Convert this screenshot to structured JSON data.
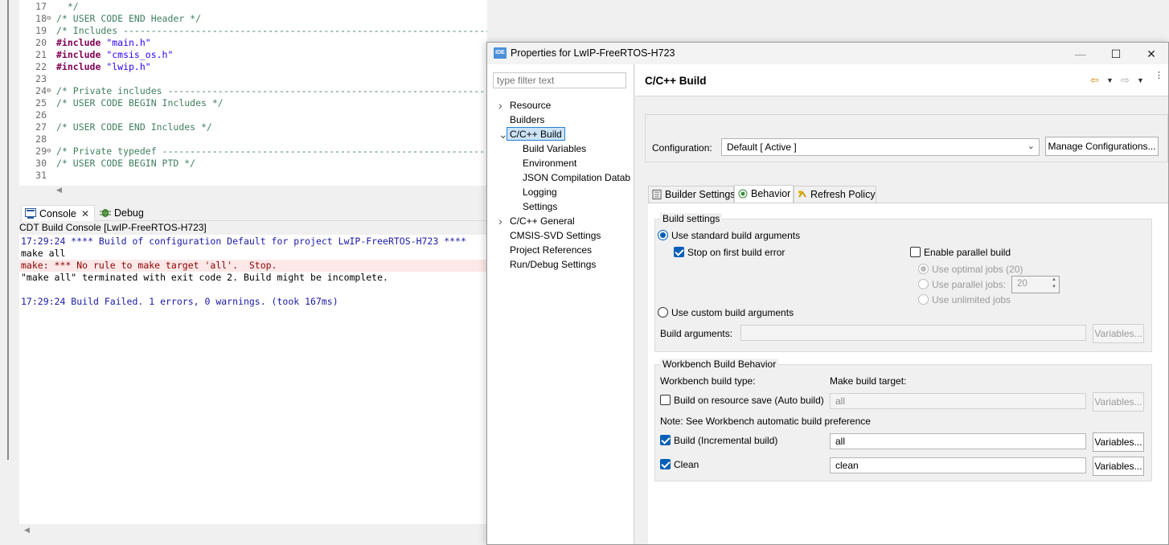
{
  "editor": {
    "lines": [
      {
        "num": "17",
        "fold": "",
        "segs": [
          {
            "t": "  */",
            "c": "c-comment"
          }
        ]
      },
      {
        "num": "18",
        "fold": "⊖",
        "segs": [
          {
            "t": "/* USER CODE END Header */",
            "c": "c-comment"
          }
        ]
      },
      {
        "num": "19",
        "fold": "",
        "segs": [
          {
            "t": "/* Includes ------------------------------------------------------------------*/",
            "c": "c-comment"
          }
        ]
      },
      {
        "num": "20",
        "fold": "",
        "segs": [
          {
            "t": "#include",
            "c": "c-kw"
          },
          {
            "t": " \"main.h\"",
            "c": "c-str"
          }
        ]
      },
      {
        "num": "21",
        "fold": "",
        "segs": [
          {
            "t": "#include",
            "c": "c-kw"
          },
          {
            "t": " \"cmsis_os.h\"",
            "c": "c-str"
          }
        ]
      },
      {
        "num": "22",
        "fold": "",
        "segs": [
          {
            "t": "#include",
            "c": "c-kw"
          },
          {
            "t": " \"lwip.h\"",
            "c": "c-str"
          }
        ]
      },
      {
        "num": "23",
        "fold": "",
        "segs": [
          {
            "t": "",
            "c": ""
          }
        ]
      },
      {
        "num": "24",
        "fold": "⊖",
        "segs": [
          {
            "t": "/* Private includes ----------------------------------------------------------",
            "c": "c-comment"
          }
        ]
      },
      {
        "num": "25",
        "fold": "",
        "segs": [
          {
            "t": "/* USER CODE BEGIN Includes */",
            "c": "c-comment"
          }
        ]
      },
      {
        "num": "26",
        "fold": "",
        "segs": [
          {
            "t": "",
            "c": ""
          }
        ]
      },
      {
        "num": "27",
        "fold": "",
        "segs": [
          {
            "t": "/* USER CODE END Includes */",
            "c": "c-comment"
          }
        ]
      },
      {
        "num": "28",
        "fold": "",
        "segs": [
          {
            "t": "",
            "c": ""
          }
        ]
      },
      {
        "num": "29",
        "fold": "⊖",
        "segs": [
          {
            "t": "/* Private typedef -----------------------------------------------------------",
            "c": "c-comment"
          }
        ]
      },
      {
        "num": "30",
        "fold": "",
        "segs": [
          {
            "t": "/* USER CODE BEGIN PTD */",
            "c": "c-comment"
          }
        ]
      },
      {
        "num": "31",
        "fold": "",
        "segs": [
          {
            "t": "",
            "c": ""
          }
        ]
      }
    ]
  },
  "console": {
    "tab_label": "Console",
    "debug_tab_label": "Debug",
    "title": "CDT Build Console [LwIP-FreeRTOS-H723]",
    "lines": [
      {
        "text": "17:29:24 **** Build of configuration Default for project LwIP-FreeRTOS-H723 ****",
        "style": "con-blue"
      },
      {
        "text": "make all",
        "style": ""
      },
      {
        "text": "make: *** No rule to make target 'all'.  Stop.",
        "style": "con-err"
      },
      {
        "text": "\"make all\" terminated with exit code 2. Build might be incomplete.",
        "style": ""
      },
      {
        "text": "",
        "style": ""
      },
      {
        "text": "17:29:24 Build Failed. 1 errors, 0 warnings. (took 167ms)",
        "style": "con-blue"
      }
    ]
  },
  "dialog": {
    "app_icon": "IDE",
    "title": "Properties for LwIP-FreeRTOS-H723",
    "window_controls": {
      "minimize": "—",
      "maximize": "☐",
      "close": "✕"
    },
    "filter_placeholder": "type filter text",
    "tree": [
      {
        "label": "Resource",
        "level": 0,
        "arrow": ">",
        "selected": false
      },
      {
        "label": "Builders",
        "level": 0,
        "arrow": "",
        "selected": false
      },
      {
        "label": "C/C++ Build",
        "level": 0,
        "arrow": "v",
        "selected": true
      },
      {
        "label": "Build Variables",
        "level": 1,
        "arrow": "",
        "selected": false
      },
      {
        "label": "Environment",
        "level": 1,
        "arrow": "",
        "selected": false
      },
      {
        "label": "JSON Compilation Datab",
        "level": 1,
        "arrow": "",
        "selected": false
      },
      {
        "label": "Logging",
        "level": 1,
        "arrow": "",
        "selected": false
      },
      {
        "label": "Settings",
        "level": 1,
        "arrow": "",
        "selected": false
      },
      {
        "label": "C/C++ General",
        "level": 0,
        "arrow": ">",
        "selected": false
      },
      {
        "label": "CMSIS-SVD Settings",
        "level": 0,
        "arrow": "",
        "selected": false
      },
      {
        "label": "Project References",
        "level": 0,
        "arrow": "",
        "selected": false
      },
      {
        "label": "Run/Debug Settings",
        "level": 0,
        "arrow": "",
        "selected": false
      }
    ],
    "page_title": "C/C++ Build",
    "configuration_label": "Configuration:",
    "configuration_value": "Default  [ Active ]",
    "manage_configurations": "Manage Configurations...",
    "tabs": [
      {
        "label": "Builder Settings",
        "icon": "list-icon",
        "active": false
      },
      {
        "label": "Behavior",
        "icon": "radio-icon",
        "active": true
      },
      {
        "label": "Refresh Policy",
        "icon": "refresh-icon",
        "active": false
      }
    ],
    "build_settings": {
      "title": "Build settings",
      "use_standard": "Use standard build arguments",
      "stop_on_first": "Stop on first build error",
      "enable_parallel": "Enable parallel build",
      "use_optimal": "Use optimal jobs (20)",
      "use_parallel": "Use parallel jobs:",
      "parallel_jobs_value": "20",
      "use_unlimited": "Use unlimited jobs",
      "use_custom": "Use custom build arguments",
      "build_arguments_label": "Build arguments:",
      "variables": "Variables..."
    },
    "workbench": {
      "title": "Workbench Build Behavior",
      "build_type_label": "Workbench build type:",
      "make_target_label": "Make build target:",
      "auto_build_label": "Build on resource save (Auto build)",
      "auto_build_value": "all",
      "note": "Note: See Workbench automatic build preference",
      "incremental_label": "Build (Incremental build)",
      "incremental_value": "all",
      "clean_label": "Clean",
      "clean_value": "clean",
      "variables": "Variables..."
    }
  }
}
